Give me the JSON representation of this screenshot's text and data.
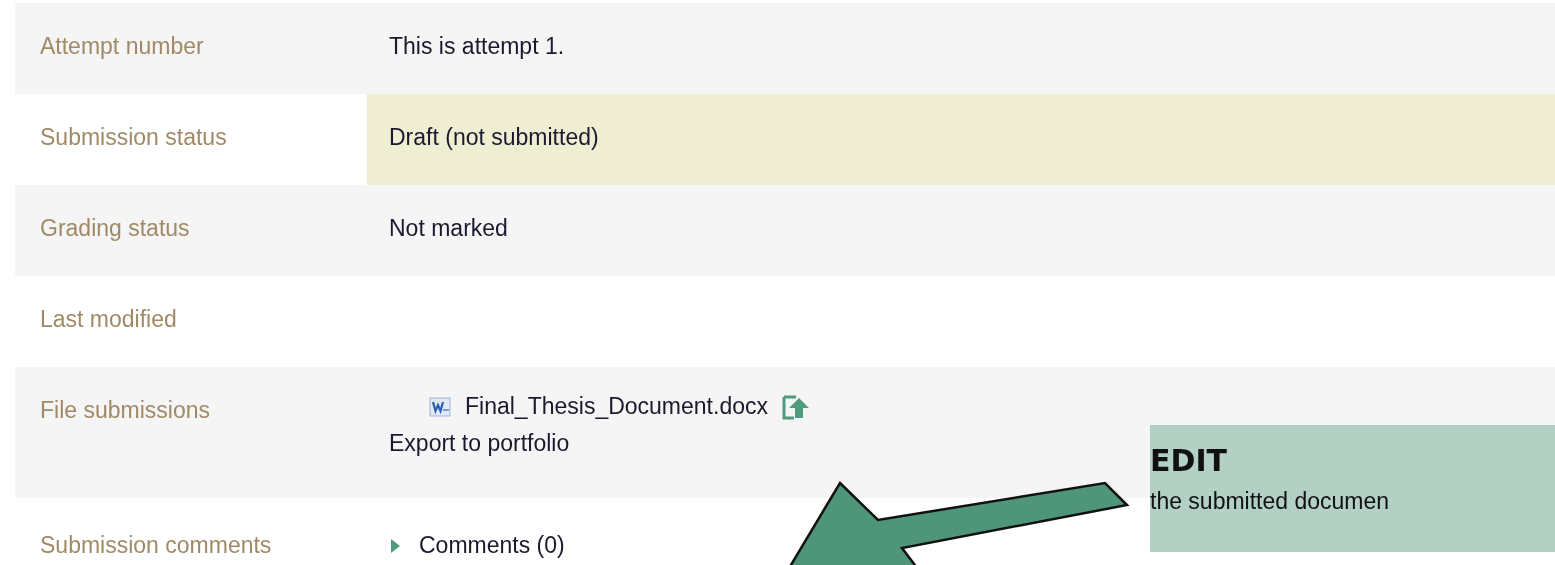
{
  "submission_rows": [
    {
      "label": "Attempt number",
      "kind": "text",
      "value": "This is attempt 1.",
      "highlighted": false
    },
    {
      "label": "Submission status",
      "kind": "text",
      "value": "Draft (not submitted)",
      "highlighted": true
    },
    {
      "label": "Grading status",
      "kind": "text",
      "value": "Not marked",
      "highlighted": false
    },
    {
      "label": "Last modified",
      "kind": "text",
      "highlighted": false
    },
    {
      "label": "File submissions",
      "kind": "files",
      "files": [
        {
          "name": "Final_Thesis_Document.docx"
        }
      ],
      "export_link": "Export to portfolio",
      "highlighted": false
    },
    {
      "label": "Submission comments",
      "kind": "comments",
      "toggle": "Comments (0)",
      "expanded": false,
      "highlighted": false
    }
  ],
  "callout": {
    "title": "EDIT",
    "text": "the submitted documen"
  }
}
